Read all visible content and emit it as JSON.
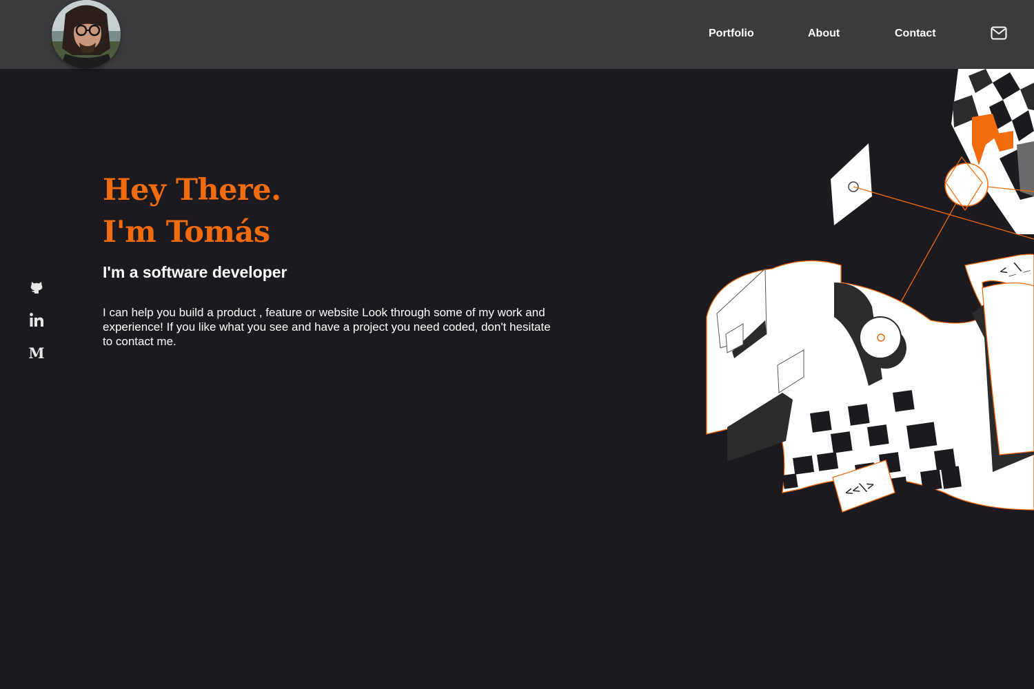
{
  "header": {
    "avatar_alt": "Profile photo",
    "nav": [
      {
        "label": "Portfolio"
      },
      {
        "label": "About"
      },
      {
        "label": "Contact"
      }
    ],
    "mail_icon": "envelope-icon"
  },
  "socials": [
    {
      "name": "GitHub",
      "icon": "github-icon"
    },
    {
      "name": "LinkedIn",
      "icon": "linkedin-icon",
      "glyph": "in"
    },
    {
      "name": "Medium",
      "icon": "medium-icon",
      "glyph": "M"
    }
  ],
  "hero": {
    "greeting": "Hey There.",
    "name_line": "I'm Tomás",
    "subtitle": "I'm a software developer",
    "intro": "I can help you build a product , feature or website Look through some of my work and experience! If you like what you see and have a project you need coded, don't hesitate to contact me."
  },
  "illustration": {
    "code_tag_top": "<_\\_",
    "code_tag_bottom": "<<\\>"
  },
  "colors": {
    "accent": "#f26b0f",
    "background": "#1c1a1e",
    "header": "#3c3a3d",
    "text": "#ffffff"
  }
}
